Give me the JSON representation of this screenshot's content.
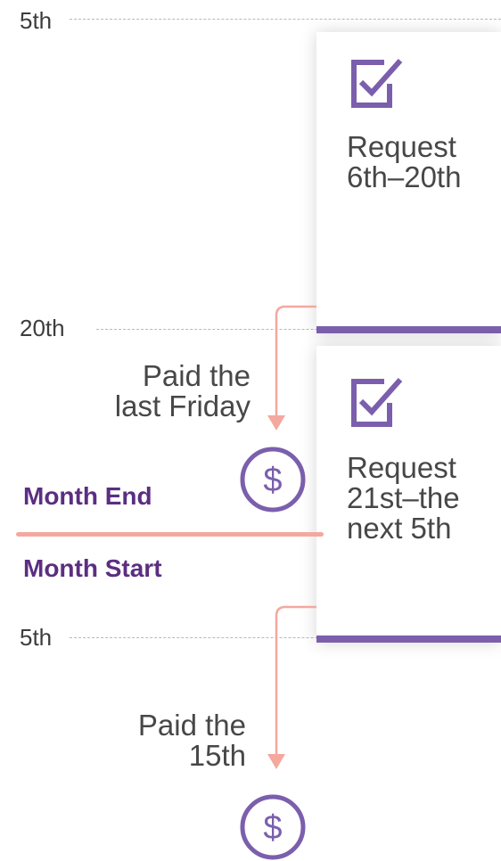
{
  "timeline": {
    "tick_5th_top": "5th",
    "tick_20th": "20th",
    "tick_5th_bottom": "5th"
  },
  "cards": [
    {
      "text_line1": "Request",
      "text_line2": "6th–20th",
      "icon": "checkbox-icon"
    },
    {
      "text_line1": "Request",
      "text_line2": "21st–the",
      "text_line3": "next 5th",
      "icon": "checkbox-icon"
    }
  ],
  "payments": [
    {
      "line1": "Paid the",
      "line2": "last Friday",
      "icon": "dollar-icon"
    },
    {
      "line1": "Paid the",
      "line2": "15th",
      "icon": "dollar-icon"
    }
  ],
  "sections": {
    "month_end": "Month End",
    "month_start": "Month Start"
  },
  "colors": {
    "accent_purple": "#7b5fad",
    "label_purple": "#5b2e82",
    "salmon": "#f4a89e",
    "dashed_line": "#b8b8b8"
  }
}
